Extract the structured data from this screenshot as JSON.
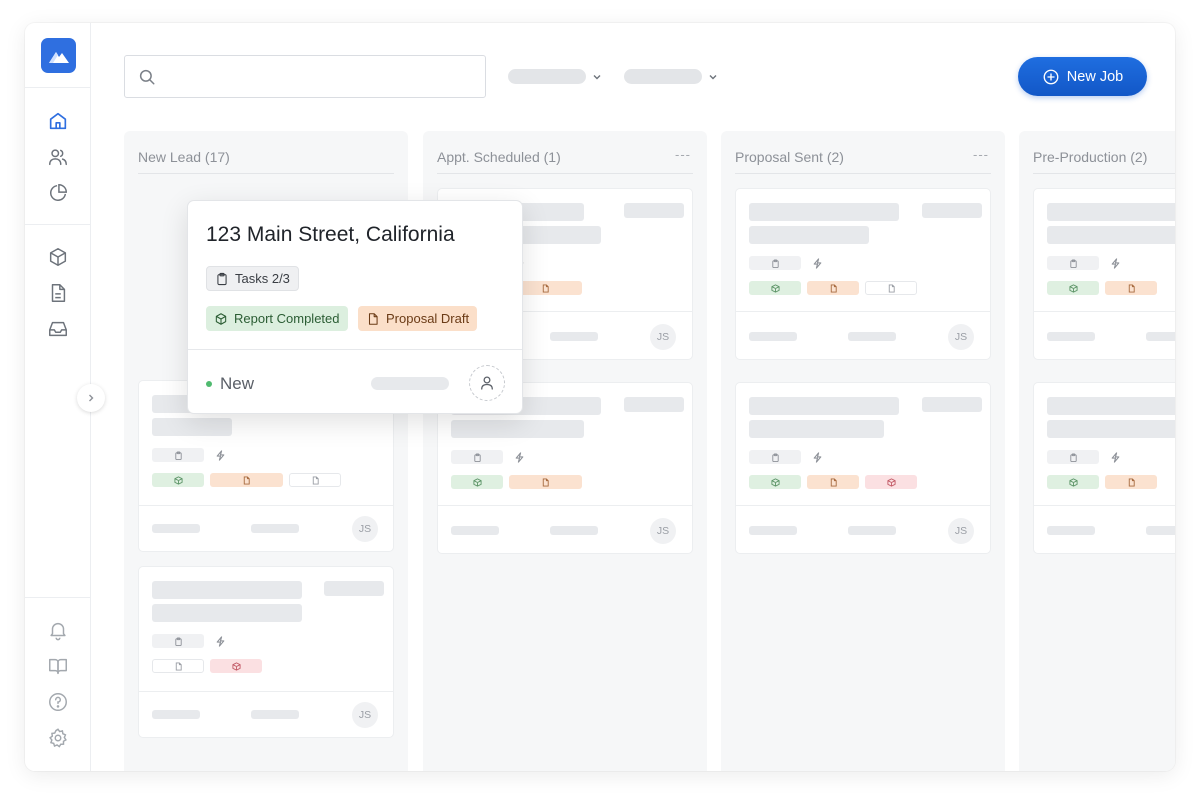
{
  "header": {
    "new_job_label": "New Job"
  },
  "columns": [
    {
      "title": "New Lead (17)",
      "menu": ""
    },
    {
      "title": "Appt. Scheduled (1)",
      "menu": "---"
    },
    {
      "title": "Proposal Sent (2)",
      "menu": "---"
    },
    {
      "title": "Pre-Production (2)",
      "menu": ""
    }
  ],
  "popup": {
    "address": "123 Main Street, California",
    "tasks_label": "Tasks 2/3",
    "report_tag": "Report Completed",
    "proposal_tag": "Proposal Draft",
    "status": "New"
  },
  "avatar_initials": "JS",
  "colors": {
    "accent": "#1a63d6",
    "logo": "#2f6fe0",
    "status_new": "#4fba6f",
    "tag_green": "#dff0e1",
    "tag_orange": "#fbe2d0",
    "tag_red": "#fbe0e2"
  },
  "icons": {
    "sidebar_top": [
      "home-icon",
      "users-icon",
      "pie-chart-icon"
    ],
    "sidebar_middle": [
      "cube-icon",
      "document-icon",
      "inbox-icon"
    ],
    "sidebar_bottom": [
      "bell-icon",
      "book-icon",
      "help-icon",
      "settings-icon"
    ]
  }
}
